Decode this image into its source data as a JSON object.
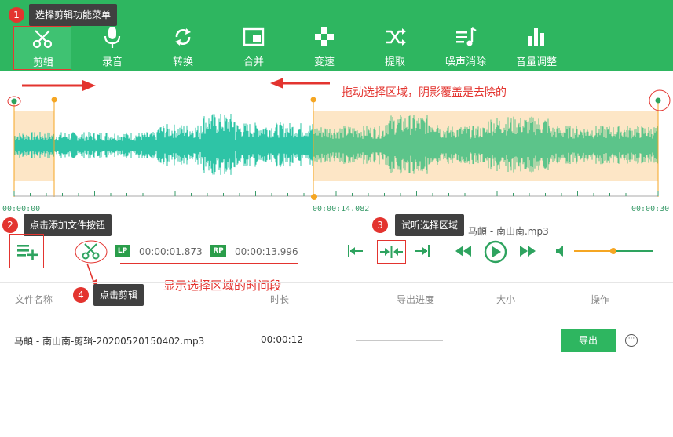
{
  "toolbar": {
    "items": [
      {
        "label": "剪辑",
        "icon": "scissors-icon"
      },
      {
        "label": "录音",
        "icon": "microphone-icon"
      },
      {
        "label": "转换",
        "icon": "convert-icon"
      },
      {
        "label": "合并",
        "icon": "merge-icon"
      },
      {
        "label": "变速",
        "icon": "speed-icon"
      },
      {
        "label": "提取",
        "icon": "extract-icon"
      },
      {
        "label": "噪声消除",
        "icon": "noise-reduction-icon"
      },
      {
        "label": "音量调整",
        "icon": "volume-adjust-icon"
      }
    ]
  },
  "annotations": {
    "a1": {
      "num": "1",
      "text": "选择剪辑功能菜单"
    },
    "a2": {
      "num": "2",
      "text": "点击添加文件按钮"
    },
    "a3": {
      "num": "3",
      "text": "试听选择区域"
    },
    "a4": {
      "num": "4",
      "text": "点击剪辑"
    },
    "drag_hint": "拖动选择区域，阴影覆盖是去除的",
    "time_hint": "显示选择区域的时间段"
  },
  "timeline": {
    "start": "00:00:00",
    "mid": "00:00:14.082",
    "end": "00:00:30"
  },
  "player": {
    "filename": "马頔 - 南山南.mp3",
    "lp_label": "LP",
    "lp_time": "00:00:01.873",
    "rp_label": "RP",
    "rp_time": "00:00:13.996",
    "volume_level": 0.5
  },
  "table": {
    "headers": {
      "name": "文件名称",
      "duration": "时长",
      "progress": "导出进度",
      "size": "大小",
      "action": "操作"
    },
    "rows": [
      {
        "name": "马頔 - 南山南-剪辑-20200520150402.mp3",
        "duration": "00:00:12",
        "progress": "",
        "size": "",
        "action": "导出"
      }
    ]
  },
  "colors": {
    "brand": "#2eb660",
    "annotation": "#e3342f",
    "wave": "#2ec4a6",
    "wave_selected": "#5cc48a",
    "shade": "#fde6c6",
    "marker": "#f5a623"
  }
}
